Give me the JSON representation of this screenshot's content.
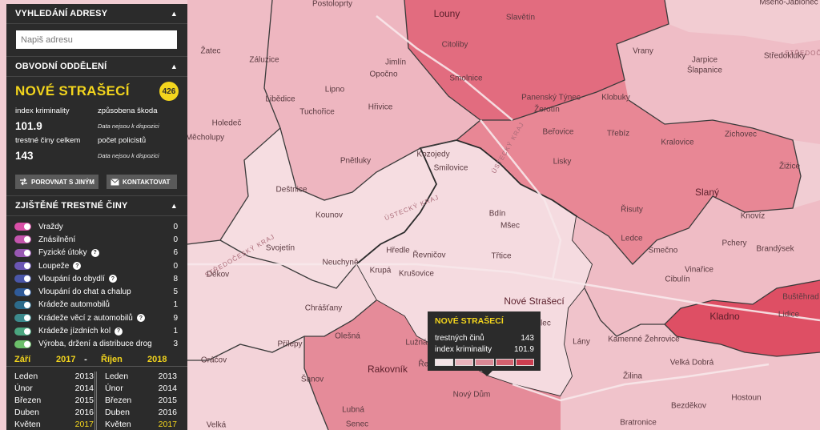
{
  "search": {
    "header": "VYHLEDÁNÍ ADRESY",
    "placeholder": "Napiš adresu"
  },
  "department": {
    "header": "OBVODNÍ ODDĚLENÍ",
    "name": "NOVÉ STRAŠECÍ",
    "badge": "426",
    "crime_index_label": "index kriminality",
    "crime_index_value": "101.9",
    "damage_label": "způsobena škoda",
    "damage_value": "Data nejsou k dispozici",
    "total_label": "trestné činy celkem",
    "total_value": "143",
    "police_label": "počet policistů",
    "police_value": "Data nejsou k dispozici",
    "compare_button": "POROVNAT S JINÝM",
    "contact_button": "KONTAKTOVAT"
  },
  "crimes": {
    "header": "ZJIŠTĚNÉ TRESTNÉ ČINY",
    "items": [
      {
        "label": "Vraždy",
        "count": "0",
        "color": "#d94fa7",
        "help": false
      },
      {
        "label": "Znásilnění",
        "count": "0",
        "color": "#c455ad",
        "help": false
      },
      {
        "label": "Fyzické útoky",
        "count": "6",
        "color": "#9858b2",
        "help": true
      },
      {
        "label": "Loupeže",
        "count": "0",
        "color": "#6b56b3",
        "help": true
      },
      {
        "label": "Vloupání do obydlí",
        "count": "8",
        "color": "#4a56a8",
        "help": true
      },
      {
        "label": "Vloupání do chat a chalup",
        "count": "5",
        "color": "#2f5a98",
        "help": false
      },
      {
        "label": "Krádeže automobilů",
        "count": "1",
        "color": "#2c6a8a",
        "help": false
      },
      {
        "label": "Krádeže věcí z automobilů",
        "count": "9",
        "color": "#3c8a8c",
        "help": true
      },
      {
        "label": "Krádeže jízdních kol",
        "count": "1",
        "color": "#4ba57f",
        "help": true
      },
      {
        "label": "Výroba, držení a distribuce drog",
        "count": "3",
        "color": "#6cbf6a",
        "help": false
      }
    ]
  },
  "period": {
    "from_month": "Září",
    "from_year": "2017",
    "separator": "-",
    "to_month": "Říjen",
    "to_year": "2018",
    "left": [
      {
        "month": "Leden",
        "year": "2013"
      },
      {
        "month": "Únor",
        "year": "2014"
      },
      {
        "month": "Březen",
        "year": "2015"
      },
      {
        "month": "Duben",
        "year": "2016"
      },
      {
        "month": "Květen",
        "year": "2017"
      }
    ],
    "right": [
      {
        "month": "Leden",
        "year": "2013"
      },
      {
        "month": "Únor",
        "year": "2014"
      },
      {
        "month": "Březen",
        "year": "2015"
      },
      {
        "month": "Duben",
        "year": "2016"
      },
      {
        "month": "Květen",
        "year": "2017"
      }
    ]
  },
  "tooltip": {
    "title": "NOVÉ STRAŠECÍ",
    "crimes_label": "trestných činů",
    "crimes_value": "143",
    "index_label": "index kriminality",
    "index_value": "101.9",
    "legend_colors": [
      "#f3e3e6",
      "#e8b3bc",
      "#d98794",
      "#d4616f",
      "#cc3e50"
    ]
  },
  "map": {
    "places": [
      "Postoloprty",
      "Louny",
      "Slavětín",
      "Mšeno-Jablonec",
      "Žatec",
      "Citoliby",
      "Vrany",
      "Jarpice",
      "Středokluky",
      "Záluzice",
      "Jimlín",
      "Opočno",
      "Smolnice",
      "Třebíz",
      "Šlapanice",
      "Lipno",
      "Panenský Týnec",
      "Klobuky",
      "Libědice",
      "Tuchořice",
      "Hřivice",
      "Žerotín",
      "Holedeč",
      "Zichovec",
      "Beřovice",
      "Měcholupy",
      "Kozojedy",
      "Lisky",
      "Kralovice",
      "Pnětluky",
      "Smilovice",
      "Žižice",
      "Deštnice",
      "Slaný",
      "Bdín",
      "Řisuty",
      "Knovíz",
      "Kounov",
      "Mšec",
      "Hředle",
      "Ledce",
      "Pchery",
      "Svojetín",
      "Řevničov",
      "Smečno",
      "Brandýsek",
      "Třtice",
      "Neuchyně",
      "Děkov",
      "Krupá",
      "Krušovice",
      "Vinařice",
      "Cibulín",
      "Buštěhrad",
      "Nové Strašecí",
      "Kladno",
      "Chrášťany",
      "Ryhholec",
      "Lidice",
      "Olešná",
      "Lužná",
      "Lány",
      "Kamenné Žehrovice",
      "Přílepy",
      "Řevničov",
      "Oráčov",
      "Rakovník",
      "Žilina",
      "Velká Dobrá",
      "Šanov",
      "Nový Dům",
      "Hostoun",
      "Lubná",
      "Bezděkov",
      "Velká",
      "Senec",
      "Bratronice"
    ]
  }
}
